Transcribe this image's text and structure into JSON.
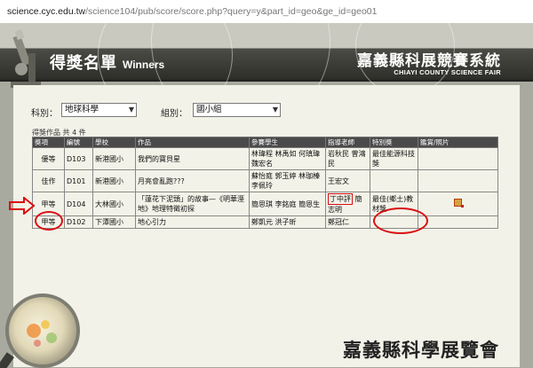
{
  "url": {
    "host": "science.cyc.edu.tw",
    "path": "/science104/pub/score/score.php?query=y&part_id=geo&ge_id=geo01"
  },
  "header": {
    "title": "得獎名單",
    "title_en": "Winners",
    "site_zh": "嘉義縣科展競賽系統",
    "site_en": "CHIAYI COUNTY SCIENCE FAIR"
  },
  "filters": {
    "subject_label": "科別：",
    "subject_value": "地球科學",
    "group_label": "組別：",
    "group_value": "國小組"
  },
  "count_text": "得獎作品 共 4 件",
  "table": {
    "headers": [
      "獎項",
      "編號",
      "學校",
      "作品",
      "參賽學生",
      "指導老師",
      "特別獎",
      "鑑賞/照片"
    ],
    "rows": [
      {
        "award": "優等",
        "id": "D103",
        "school": "新港國小",
        "work": "我們的寶貝星",
        "students": "林瑋程 林禹如 何瑱瑋 魏宏名",
        "teachers": "岩秋民 曾鴻民",
        "special": "最佳能源科技獎",
        "media": ""
      },
      {
        "award": "佳作",
        "id": "D101",
        "school": "新港國小",
        "work": "月亮會亂跑???",
        "students": "蘇怡庭 郭玉婷 林珈榛 李佩玲",
        "teachers": "王宏文",
        "special": "",
        "media": ""
      },
      {
        "award": "甲等",
        "id": "D104",
        "school": "大林國小",
        "work": "「蓮花下泥頭」的故事—《明華溼地》地理特徵初探",
        "students": "簡思琪 李銘庭 簡恩生",
        "teacher_boxed": "丁中評",
        "teacher_rest": "簡志明",
        "special": "最佳(鄉土)教材獎",
        "media": "certificate-icon"
      },
      {
        "award": "甲等",
        "id": "D102",
        "school": "下潭國小",
        "work": "地心引力",
        "students": "鄭凱元 洪子昕",
        "teachers": "鄭冠仁",
        "special": "",
        "media": ""
      }
    ]
  },
  "footer": {
    "logo_text": "嘉義縣科學展覽會"
  },
  "colors": {
    "header_dark": "#2f2f2b",
    "panel_bg": "#f3f2e8",
    "frame_bg": "#a9aa9f",
    "highlight_red": "#d90e12"
  }
}
